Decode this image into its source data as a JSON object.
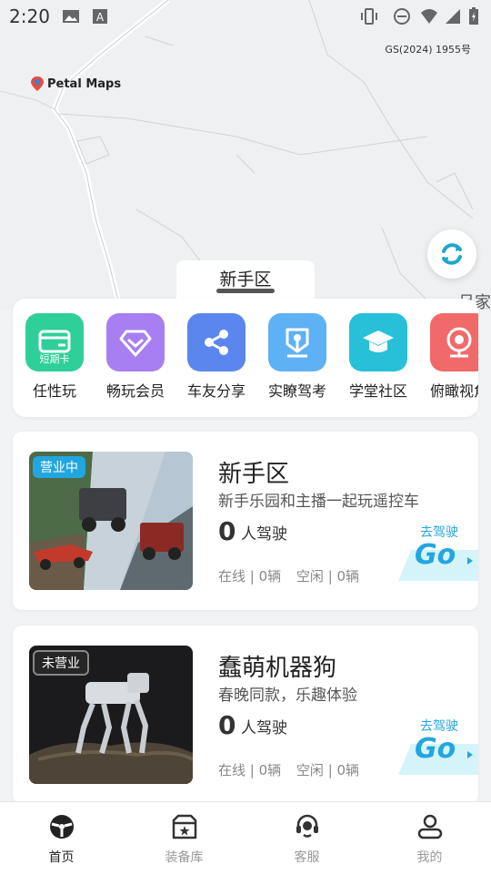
{
  "status_bar": {
    "time": "2:20"
  },
  "map": {
    "credit": "GS(2024) 1955号",
    "provider": "Petal Maps",
    "place_fragment": "吕家"
  },
  "zone_tab": {
    "label": "新手区"
  },
  "features": [
    {
      "label": "任性玩",
      "icon": "card-icon",
      "badge": "短期卡",
      "color": "#2fcf9a"
    },
    {
      "label": "畅玩会员",
      "icon": "diamond-icon",
      "color": "#a77ff2"
    },
    {
      "label": "车友分享",
      "icon": "share-icon",
      "color": "#5b86ee"
    },
    {
      "label": "实瞭驾考",
      "icon": "exam-icon",
      "color": "#5fb1f5"
    },
    {
      "label": "学堂社区",
      "icon": "graduation-cap-icon",
      "color": "#27c0d8"
    },
    {
      "label": "俯瞰视角",
      "icon": "camera-icon",
      "color": "#f06a6a"
    }
  ],
  "cards": [
    {
      "status": "营业中",
      "title": "新手区",
      "subtitle": "新手乐园和主播一起玩遥控车",
      "count": "0",
      "count_label": "人驾驶",
      "online": "在线 | 0辆",
      "idle": "空闲 | 0辆",
      "go_label": "去驾驶",
      "go_big": "Go"
    },
    {
      "status": "未营业",
      "title": "蠢萌机器狗",
      "subtitle": "春晚同款，乐趣体验",
      "count": "0",
      "count_label": "人驾驶",
      "online": "在线 | 0辆",
      "idle": "空闲 | 0辆",
      "go_label": "去驾驶",
      "go_big": "Go"
    }
  ],
  "bottom_nav": [
    {
      "label": "首页",
      "icon": "steering-wheel-icon",
      "active": true
    },
    {
      "label": "装备库",
      "icon": "garage-icon",
      "active": false
    },
    {
      "label": "客服",
      "icon": "headset-icon",
      "active": false
    },
    {
      "label": "我的",
      "icon": "user-icon",
      "active": false
    }
  ]
}
